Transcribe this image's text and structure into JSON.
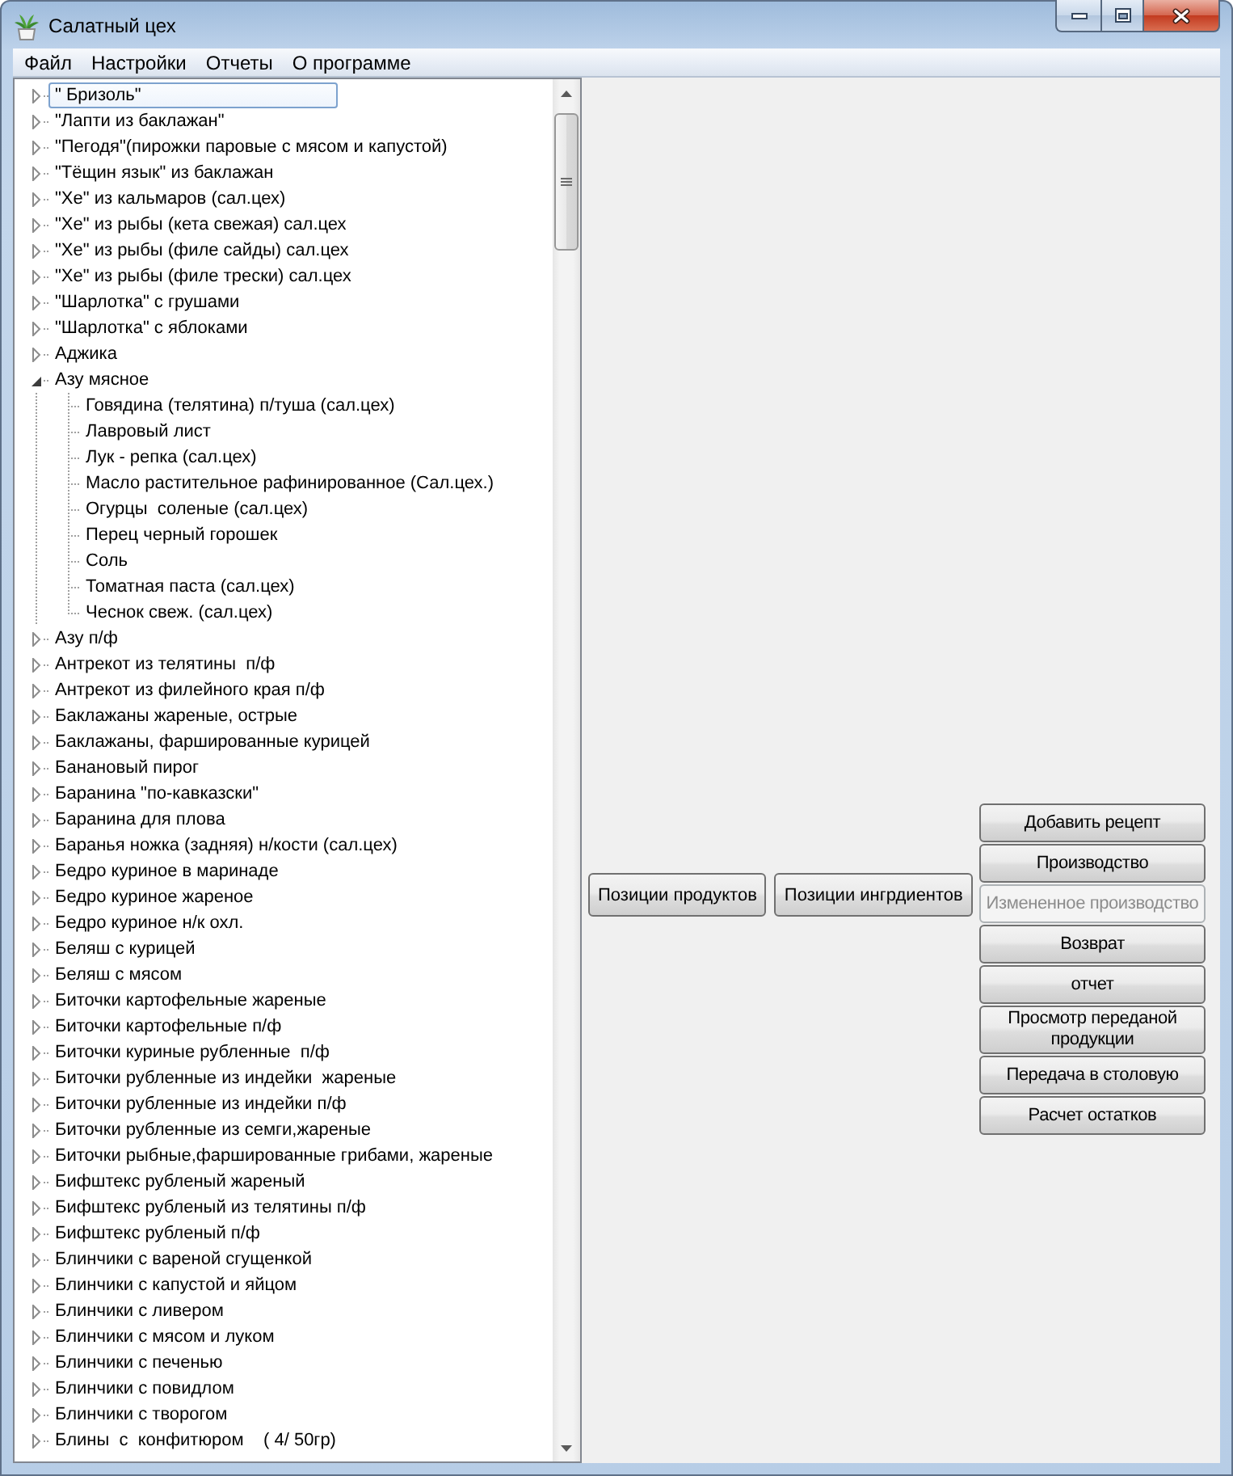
{
  "window": {
    "title": "Салатный цех"
  },
  "menu": [
    "Файл",
    "Настройки",
    "Отчеты",
    "О программе"
  ],
  "tree": {
    "items": [
      {
        "label": "\" Бризоль\"",
        "expanded": false,
        "selected": true
      },
      {
        "label": "\"Лапти из баклажан\"",
        "expanded": false,
        "selected": false
      },
      {
        "label": "\"Пегодя\"(пирожки паровые с мясом и капустой)",
        "expanded": false,
        "selected": false
      },
      {
        "label": "\"Тёщин язык\" из баклажан",
        "expanded": false,
        "selected": false
      },
      {
        "label": "\"Хе\" из кальмаров (сал.цех)",
        "expanded": false,
        "selected": false
      },
      {
        "label": "\"Хе\" из рыбы (кета свежая) сал.цех",
        "expanded": false,
        "selected": false
      },
      {
        "label": "\"Хе\" из рыбы (филе сайды) сал.цех",
        "expanded": false,
        "selected": false
      },
      {
        "label": "\"Хе\" из рыбы (филе трески) сал.цех",
        "expanded": false,
        "selected": false
      },
      {
        "label": "\"Шарлотка\" с грушами",
        "expanded": false,
        "selected": false
      },
      {
        "label": "\"Шарлотка\" с яблоками",
        "expanded": false,
        "selected": false
      },
      {
        "label": "Аджика",
        "expanded": false,
        "selected": false
      },
      {
        "label": "Азу мясное",
        "expanded": true,
        "selected": false,
        "children": [
          {
            "label": "Говядина (телятина) п/туша (сал.цех)",
            "selected": false
          },
          {
            "label": "Лавровый лист",
            "selected": false
          },
          {
            "label": "Лук - репка (сал.цех)",
            "selected": false
          },
          {
            "label": "Масло растительное рафинированное (Сал.цех.)",
            "selected": false
          },
          {
            "label": "Огурцы  соленые (сал.цех)",
            "selected": false
          },
          {
            "label": "Перец черный горошек",
            "selected": false
          },
          {
            "label": "Соль",
            "selected": false
          },
          {
            "label": "Томатная паста (сал.цех)",
            "selected": false
          },
          {
            "label": "Чеснок свеж. (сал.цех)",
            "selected": false
          }
        ]
      },
      {
        "label": "Азу п/ф",
        "expanded": false,
        "selected": false
      },
      {
        "label": "Антрекот из телятины  п/ф",
        "expanded": false,
        "selected": false
      },
      {
        "label": "Антрекот из филейного края п/ф",
        "expanded": false,
        "selected": false
      },
      {
        "label": "Баклажаны жареные, острые",
        "expanded": false,
        "selected": false
      },
      {
        "label": "Баклажаны, фаршированные курицей",
        "expanded": false,
        "selected": false
      },
      {
        "label": "Банановый пирог",
        "expanded": false,
        "selected": false
      },
      {
        "label": "Баранина \"по-кавказски\"",
        "expanded": false,
        "selected": false
      },
      {
        "label": "Баранина для плова",
        "expanded": false,
        "selected": false
      },
      {
        "label": "Баранья ножка (задняя) н/кости (сал.цех)",
        "expanded": false,
        "selected": false
      },
      {
        "label": "Бедро куриное в маринаде",
        "expanded": false,
        "selected": false
      },
      {
        "label": "Бедро куриное жареное",
        "expanded": false,
        "selected": false
      },
      {
        "label": "Бедро куриное н/к охл.",
        "expanded": false,
        "selected": false
      },
      {
        "label": "Беляш с курицей",
        "expanded": false,
        "selected": false
      },
      {
        "label": "Беляш с мясом",
        "expanded": false,
        "selected": false
      },
      {
        "label": "Биточки картофельные жареные",
        "expanded": false,
        "selected": false
      },
      {
        "label": "Биточки картофельные п/ф",
        "expanded": false,
        "selected": false
      },
      {
        "label": "Биточки куриные рубленные  п/ф",
        "expanded": false,
        "selected": false
      },
      {
        "label": "Биточки рубленные из индейки  жареные",
        "expanded": false,
        "selected": false
      },
      {
        "label": "Биточки рубленные из индейки п/ф",
        "expanded": false,
        "selected": false
      },
      {
        "label": "Биточки рубленные из семги,жареные",
        "expanded": false,
        "selected": false
      },
      {
        "label": "Биточки рыбные,фаршированные грибами, жареные",
        "expanded": false,
        "selected": false
      },
      {
        "label": "Бифштекс рубленый жареный",
        "expanded": false,
        "selected": false
      },
      {
        "label": "Бифштекс рубленый из телятины п/ф",
        "expanded": false,
        "selected": false
      },
      {
        "label": "Бифштекс рубленый п/ф",
        "expanded": false,
        "selected": false
      },
      {
        "label": "Блинчики с вареной сгущенкой",
        "expanded": false,
        "selected": false
      },
      {
        "label": "Блинчики с капустой и яйцом",
        "expanded": false,
        "selected": false
      },
      {
        "label": "Блинчики с ливером",
        "expanded": false,
        "selected": false
      },
      {
        "label": "Блинчики с мясом и луком",
        "expanded": false,
        "selected": false
      },
      {
        "label": "Блинчики с печенью",
        "expanded": false,
        "selected": false
      },
      {
        "label": "Блинчики с повидлом",
        "expanded": false,
        "selected": false
      },
      {
        "label": "Блинчики с творогом",
        "expanded": false,
        "selected": false
      },
      {
        "label": "Блины  с  конфитюром    ( 4/ 50гр)",
        "expanded": false,
        "selected": false
      }
    ]
  },
  "position_buttons": [
    "Позиции продуктов",
    "Позиции ингрдиентов"
  ],
  "action_buttons": [
    {
      "label": "Добавить рецепт",
      "disabled": false
    },
    {
      "label": "Производство",
      "disabled": false
    },
    {
      "label": "Измененное производство",
      "disabled": true
    },
    {
      "label": "Возврат",
      "disabled": false
    },
    {
      "label": "отчет",
      "disabled": false
    },
    {
      "label": "Просмотр переданой продукции",
      "disabled": false
    },
    {
      "label": "Передача в столовую",
      "disabled": false
    },
    {
      "label": "Расчет остатков",
      "disabled": false
    }
  ]
}
